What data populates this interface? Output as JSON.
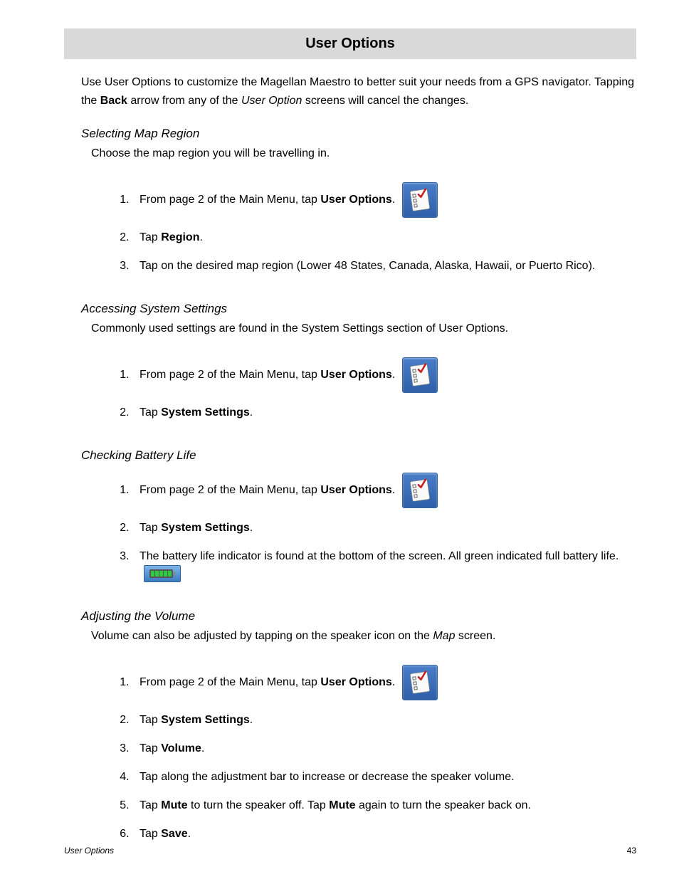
{
  "title": "User Options",
  "intro": {
    "pre": "Use User Options to customize the Magellan Maestro to better suit your needs from a GPS navigator. Tapping the ",
    "bold": "Back",
    "mid": " arrow from any of the ",
    "italic": "User Option",
    "post": " screens will cancel the changes."
  },
  "sections": {
    "region": {
      "heading": "Selecting Map Region",
      "desc": "Choose the map region you will be travelling in.",
      "step1_pre": "From page 2 of the Main Menu, tap ",
      "step1_bold": "User Options",
      "step1_post": ".",
      "step2_pre": "Tap ",
      "step2_bold": "Region",
      "step2_post": ".",
      "step3": "Tap on the desired map region (Lower 48 States, Canada, Alaska, Hawaii, or Puerto Rico)."
    },
    "system": {
      "heading": "Accessing System Settings",
      "desc": "Commonly used settings are found in the System Settings section of User Options.",
      "step1_pre": "From page 2 of the Main Menu, tap ",
      "step1_bold": "User Options",
      "step1_post": ".",
      "step2_pre": "Tap ",
      "step2_bold": "System Settings",
      "step2_post": "."
    },
    "battery": {
      "heading": "Checking Battery Life",
      "step1_pre": "From page 2 of the Main Menu, tap ",
      "step1_bold": "User Options",
      "step1_post": ".",
      "step2_pre": "Tap ",
      "step2_bold": "System Settings",
      "step2_post": ".",
      "step3": "The battery life indicator is found at the bottom of the screen.  All green indicated full battery life."
    },
    "volume": {
      "heading": "Adjusting the Volume",
      "desc_pre": "Volume can also be adjusted by tapping on the speaker icon on the ",
      "desc_italic": "Map",
      "desc_post": " screen.",
      "step1_pre": "From page 2 of the Main Menu, tap ",
      "step1_bold": "User Options",
      "step1_post": ".",
      "step2_pre": "Tap ",
      "step2_bold": "System Settings",
      "step2_post": ".",
      "step3_pre": "Tap ",
      "step3_bold": "Volume",
      "step3_post": ".",
      "step4": "Tap along the adjustment bar to increase or decrease the speaker volume.",
      "step5_pre": "Tap ",
      "step5_bold1": "Mute",
      "step5_mid": " to turn the speaker off.  Tap ",
      "step5_bold2": "Mute",
      "step5_post": " again to turn the speaker back on.",
      "step6_pre": "Tap ",
      "step6_bold": "Save",
      "step6_post": "."
    }
  },
  "footer": {
    "left": "User Options",
    "right": "43"
  }
}
